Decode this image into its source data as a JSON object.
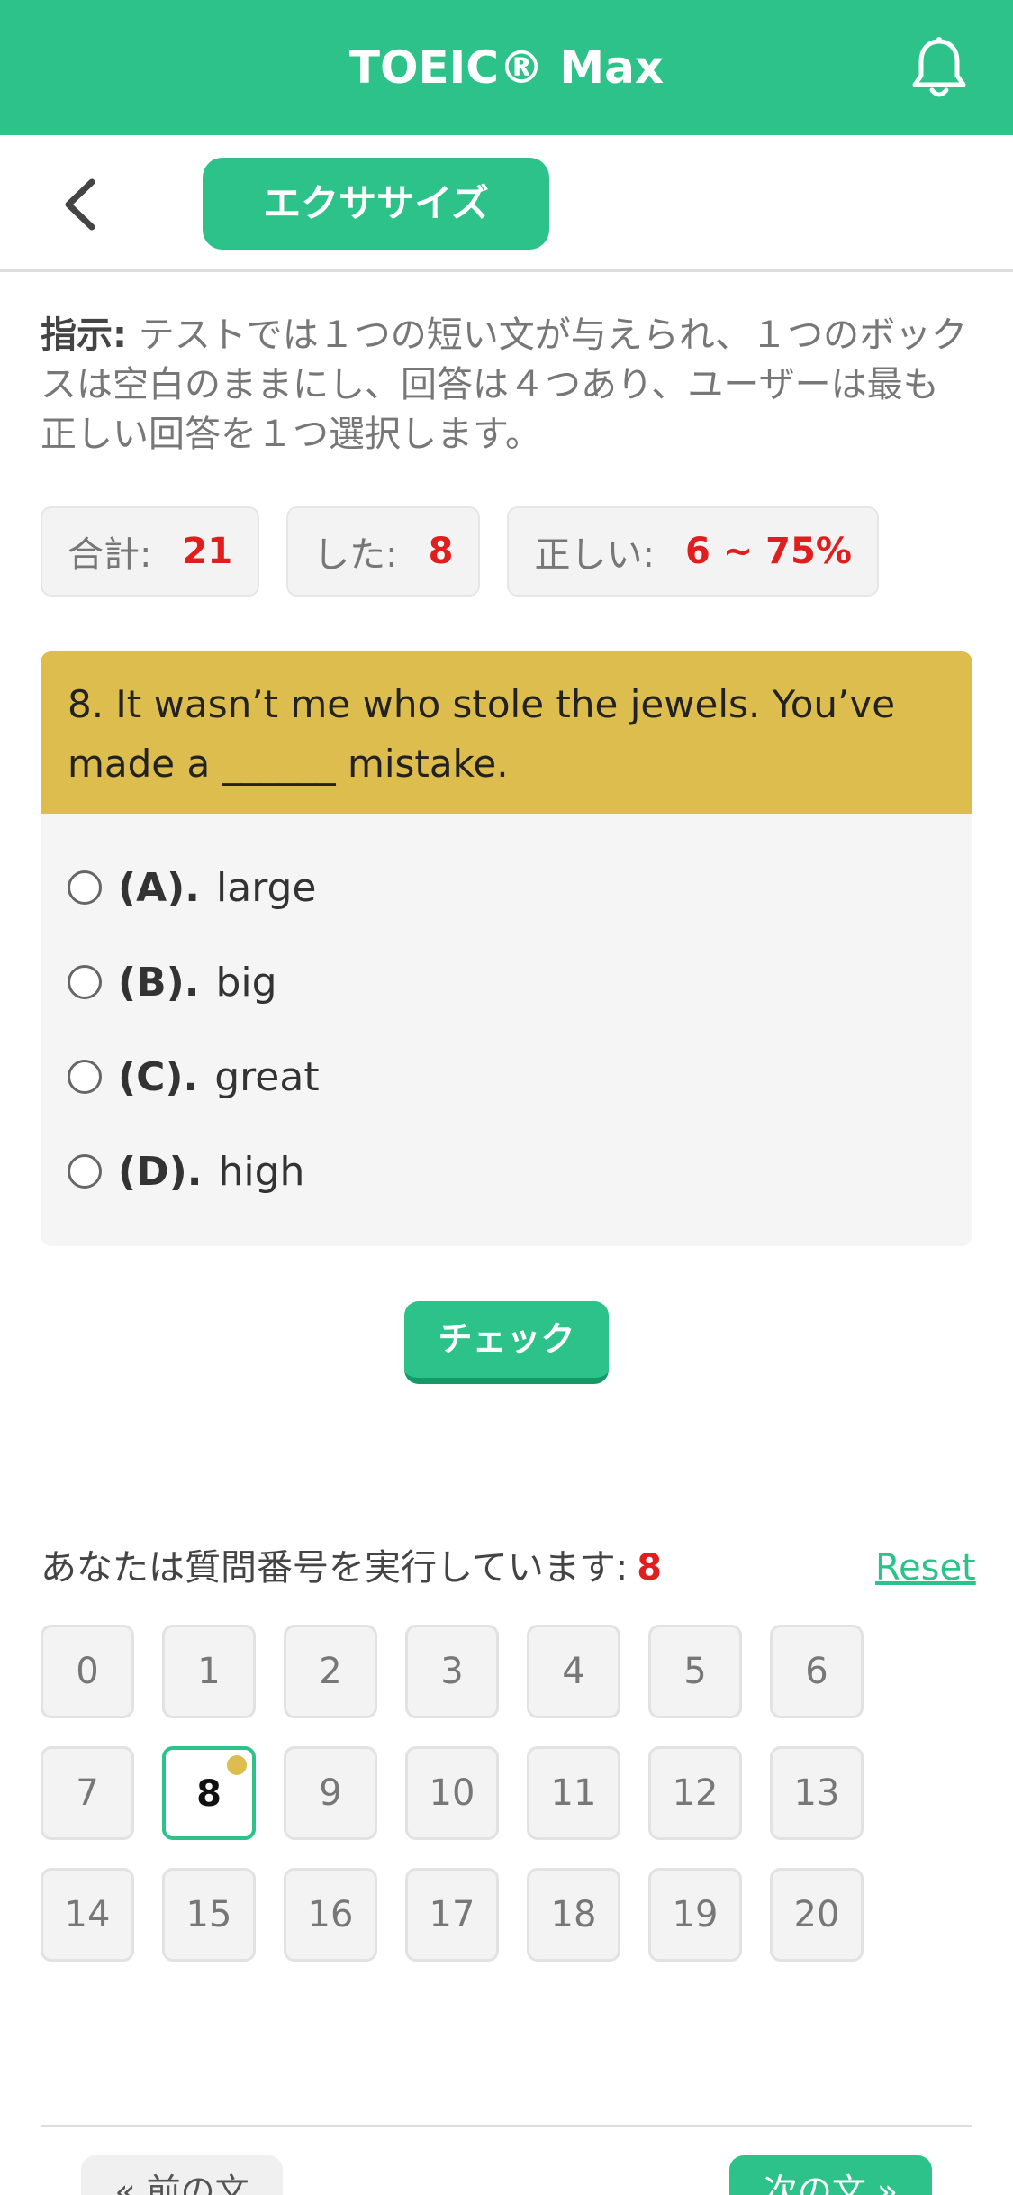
{
  "header": {
    "title": "TOEIC® Max",
    "bell_icon": "bell-icon"
  },
  "toolbar": {
    "back_icon": "chevron-left-icon",
    "tab_label": "エクササイズ"
  },
  "instructions": {
    "label": "指示:",
    "text": "テストでは１つの短い文が与えられ、１つのボックスは空白のままにし、回答は４つあり、ユーザーは最も正しい回答を１つ選択します。"
  },
  "stats": {
    "total_label": "合計:",
    "total_value": "21",
    "done_label": "した:",
    "done_value": "8",
    "correct_label": "正しい:",
    "correct_value": "6 ~ 75%"
  },
  "question": {
    "text": "8. It wasn’t me who stole the jewels. You’ve made a ______ mistake.",
    "options": [
      {
        "letter": "(A).",
        "text": "large"
      },
      {
        "letter": "(B).",
        "text": "big"
      },
      {
        "letter": "(C).",
        "text": "great"
      },
      {
        "letter": "(D).",
        "text": "high"
      }
    ]
  },
  "check_button": "チェック",
  "progress": {
    "label": "あなたは質問番号を実行しています:",
    "current": "8",
    "reset": "Reset"
  },
  "question_numbers": [
    "0",
    "1",
    "2",
    "3",
    "4",
    "5",
    "6",
    "7",
    "8",
    "9",
    "10",
    "11",
    "12",
    "13",
    "14",
    "15",
    "16",
    "17",
    "18",
    "19",
    "20"
  ],
  "nav": {
    "prev": "« 前の文",
    "next": "次の文 »"
  },
  "colors": {
    "primary": "#2cc28a",
    "question_header": "#dcbd4e",
    "highlight": "#e01e1e"
  }
}
